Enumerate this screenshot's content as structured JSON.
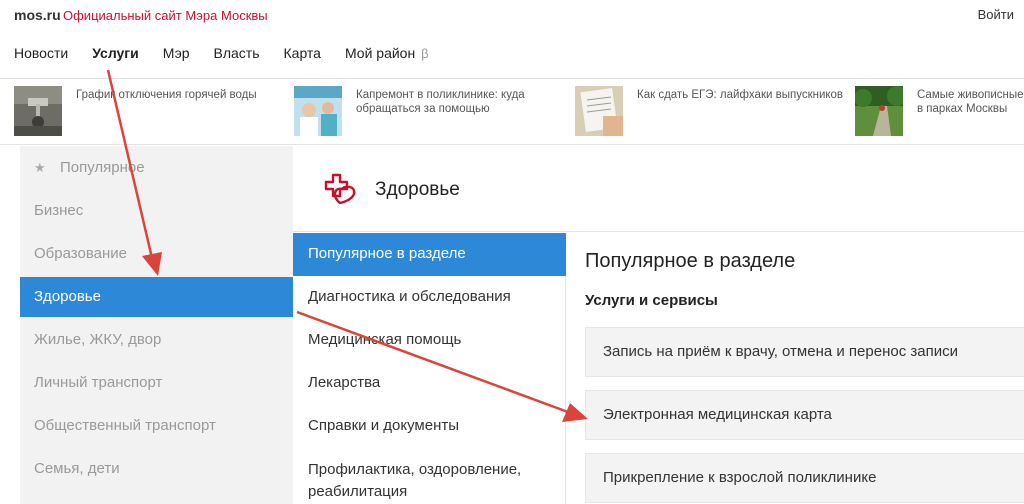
{
  "header": {
    "logo": "mos.ru",
    "site_title": "Официальный сайт Мэра Москвы",
    "login": "Войти"
  },
  "nav": {
    "items": [
      {
        "label": "Новости"
      },
      {
        "label": "Услуги",
        "active": true
      },
      {
        "label": "Мэр"
      },
      {
        "label": "Власть"
      },
      {
        "label": "Карта"
      },
      {
        "label": "Мой район"
      }
    ],
    "beta": "β"
  },
  "news": [
    {
      "text_line1": "График отключения горячей воды",
      "text_line2": ""
    },
    {
      "text_line1": "Капремонт в поликлинике: куда",
      "text_line2": "обращаться за помощью"
    },
    {
      "text_line1": "Как сдать ЕГЭ: лайфхаки выпускников",
      "text_line2": ""
    },
    {
      "text_line1": "Самые живописные",
      "text_line2": "в парках Москвы"
    }
  ],
  "categories": [
    {
      "label": "Популярное",
      "icon": "star-icon"
    },
    {
      "label": "Бизнес"
    },
    {
      "label": "Образование"
    },
    {
      "label": "Здоровье",
      "active": true
    },
    {
      "label": "Жилье, ЖКУ, двор"
    },
    {
      "label": "Личный транспорт"
    },
    {
      "label": "Общественный транспорт"
    },
    {
      "label": "Семья, дети"
    }
  ],
  "section": {
    "title": "Здоровье",
    "icon": "heart-cross-icon"
  },
  "subsections": [
    {
      "line1": "Популярное в разделе",
      "line2": "",
      "active": true
    },
    {
      "line1": "Диагностика и обследования",
      "line2": ""
    },
    {
      "line1": "Медицинская помощь",
      "line2": ""
    },
    {
      "line1": "Лекарства",
      "line2": ""
    },
    {
      "line1": "Справки и документы",
      "line2": ""
    },
    {
      "line1": "Профилактика, оздоровление,",
      "line2": "реабилитация"
    }
  ],
  "content": {
    "title": "Популярное в разделе",
    "subtitle": "Услуги и сервисы",
    "services": [
      {
        "label": "Запись на приём к врачу, отмена и перенос записи"
      },
      {
        "label": "Электронная медицинская карта"
      },
      {
        "label": "Прикрепление к взрослой поликлинике"
      }
    ]
  },
  "colors": {
    "brand_red": "#c8102e",
    "accent_blue": "#2d88d8",
    "annotation_arrow": "#d9453a"
  }
}
